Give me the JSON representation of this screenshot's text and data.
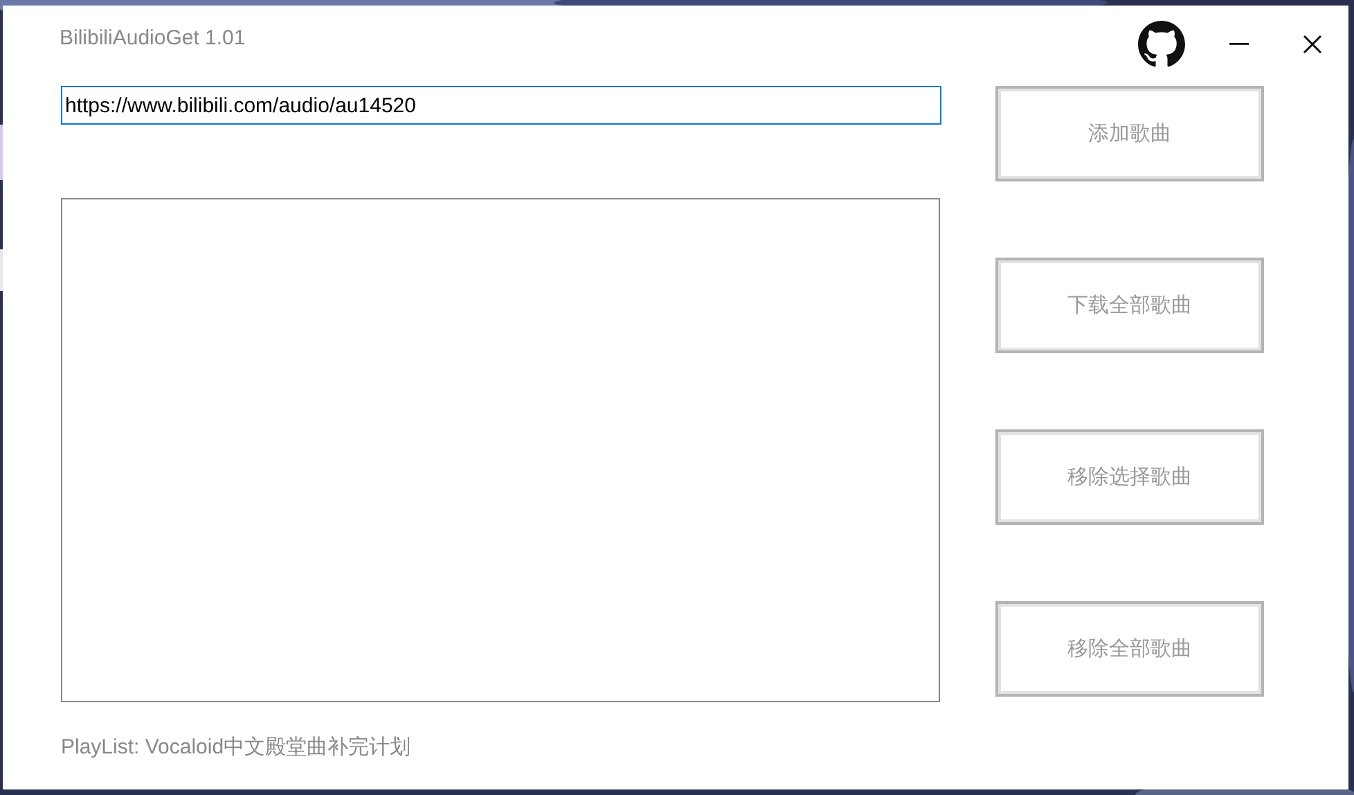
{
  "window": {
    "title": "BilibiliAudioGet 1.01"
  },
  "url_field": {
    "value": "https://www.bilibili.com/audio/au14520"
  },
  "buttons": [
    {
      "label": "添加歌曲"
    },
    {
      "label": "下载全部歌曲"
    },
    {
      "label": "移除选择歌曲"
    },
    {
      "label": "移除全部歌曲"
    }
  ],
  "playlist_label": "PlayList: Vocaloid中文殿堂曲补完计划"
}
